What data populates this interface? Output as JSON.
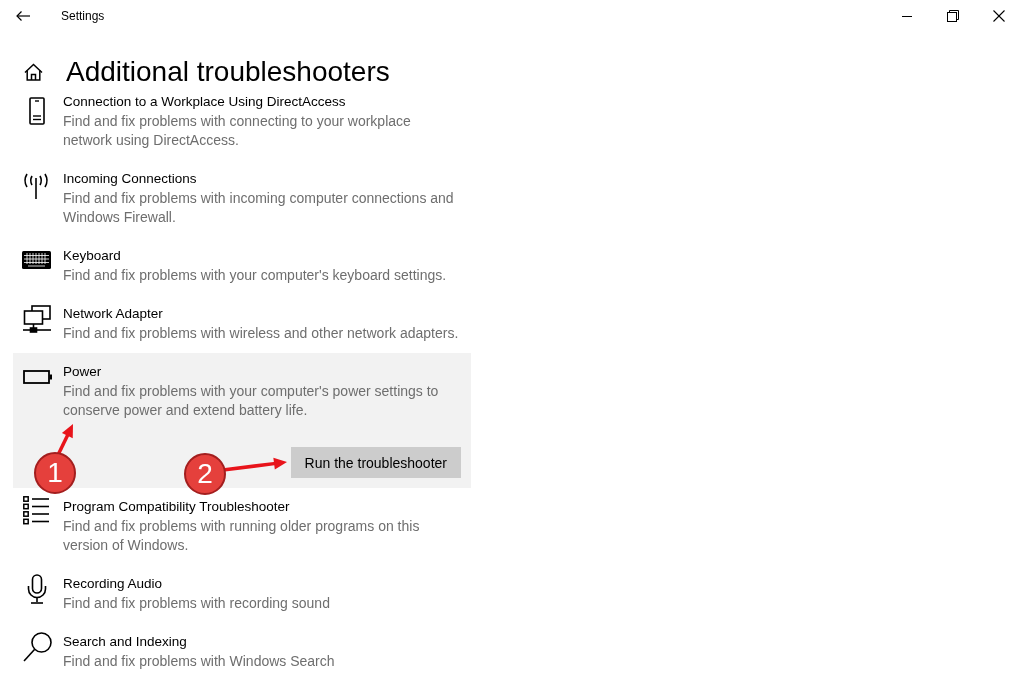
{
  "window": {
    "title": "Settings"
  },
  "page": {
    "title": "Additional troubleshooters"
  },
  "items": [
    {
      "title": "Connection to a Workplace Using DirectAccess",
      "description": "Find and fix problems with connecting to your workplace network using DirectAccess.",
      "expanded": false
    },
    {
      "title": "Incoming Connections",
      "description": "Find and fix problems with incoming computer connections and Windows Firewall.",
      "expanded": false
    },
    {
      "title": "Keyboard",
      "description": "Find and fix problems with your computer's keyboard settings.",
      "expanded": false
    },
    {
      "title": "Network Adapter",
      "description": "Find and fix problems with wireless and other network adapters.",
      "expanded": false
    },
    {
      "title": "Power",
      "description": "Find and fix problems with your computer's power settings to conserve power and extend battery life.",
      "expanded": true,
      "button": "Run the troubleshooter"
    },
    {
      "title": "Program Compatibility Troubleshooter",
      "description": "Find and fix problems with running older programs on this version of Windows.",
      "expanded": false
    },
    {
      "title": "Recording Audio",
      "description": "Find and fix problems with recording sound",
      "expanded": false
    },
    {
      "title": "Search and Indexing",
      "description": "Find and fix problems with Windows Search",
      "expanded": false
    }
  ],
  "annotations": [
    {
      "label": "1"
    },
    {
      "label": "2"
    }
  ]
}
